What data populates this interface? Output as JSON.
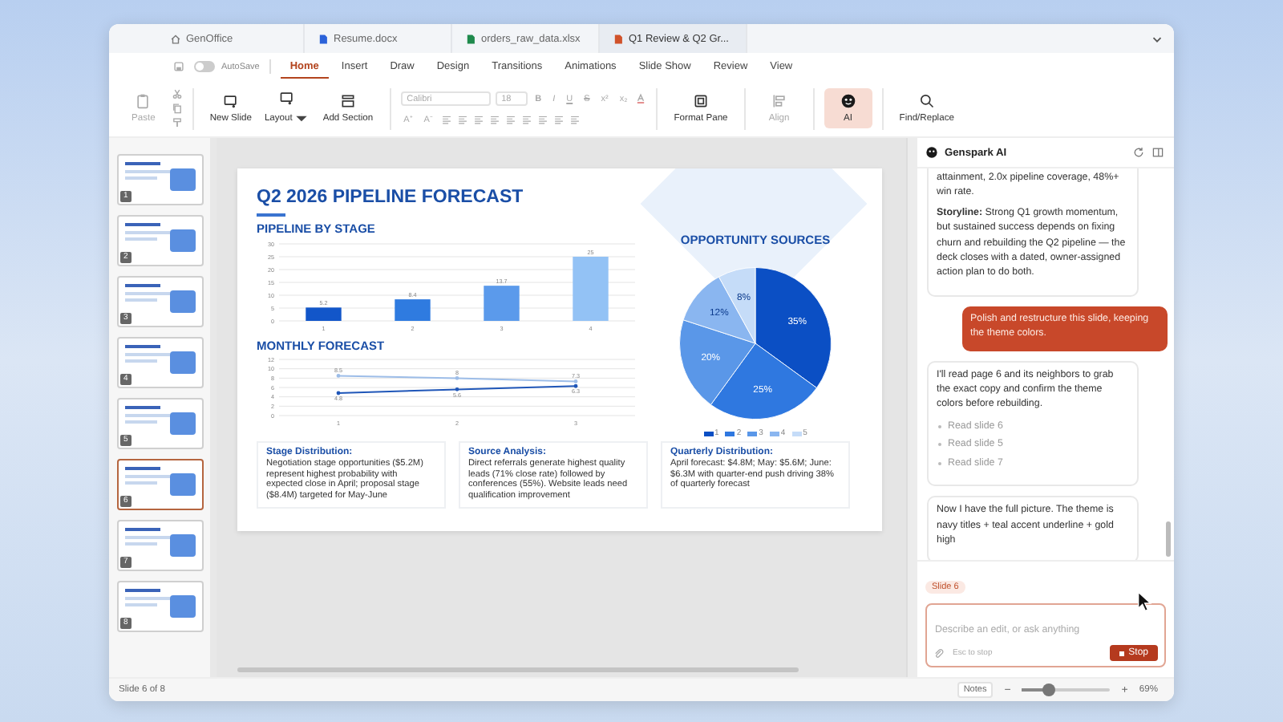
{
  "tabs": [
    {
      "label": "GenOffice",
      "kind": "home",
      "selected": false
    },
    {
      "label": "Resume.docx",
      "kind": "docx",
      "selected": false
    },
    {
      "label": "orders_raw_data.xlsx",
      "kind": "xlsx",
      "selected": false
    },
    {
      "label": "Q1 Review & Q2 Gr...",
      "kind": "pptx",
      "selected": true
    }
  ],
  "autosave": {
    "label": "AutoSave",
    "on": false
  },
  "menu": [
    {
      "label": "Home",
      "selected": true
    },
    {
      "label": "Insert",
      "selected": false
    },
    {
      "label": "Draw",
      "selected": false
    },
    {
      "label": "Design",
      "selected": false
    },
    {
      "label": "Transitions",
      "selected": false
    },
    {
      "label": "Animations",
      "selected": false
    },
    {
      "label": "Slide Show",
      "selected": false
    },
    {
      "label": "Review",
      "selected": false
    },
    {
      "label": "View",
      "selected": false
    }
  ],
  "ribbon": {
    "paste": {
      "label": "Paste",
      "disabled": true
    },
    "slide_buttons": [
      {
        "label": "New Slide",
        "kind": "new-slide"
      },
      {
        "label": "Layout",
        "kind": "layout"
      },
      {
        "label": "Add Section",
        "kind": "section"
      }
    ],
    "font": {
      "family": "Calibri",
      "size": "18",
      "disabled": true,
      "styles": [
        "B",
        "I",
        "U",
        "S",
        "x²",
        "x₂"
      ],
      "sizers": [
        "A⁺",
        "A⁻"
      ]
    },
    "tools": [
      {
        "label": "Format Pane",
        "kind": "format",
        "disabled": false,
        "selected": false
      },
      {
        "label": "Align",
        "kind": "align",
        "disabled": true,
        "selected": false
      },
      {
        "label": "AI",
        "kind": "ai",
        "disabled": false,
        "selected": true
      },
      {
        "label": "Find/Replace",
        "kind": "find",
        "disabled": false,
        "selected": false
      }
    ]
  },
  "thumbnails": [
    {
      "number": "1",
      "selected": false
    },
    {
      "number": "2",
      "selected": false
    },
    {
      "number": "3",
      "selected": false
    },
    {
      "number": "4",
      "selected": false
    },
    {
      "number": "5",
      "selected": false
    },
    {
      "number": "6",
      "selected": true
    },
    {
      "number": "7",
      "selected": false
    },
    {
      "number": "8",
      "selected": false
    }
  ],
  "slide": {
    "title": "Q2 2026 PIPELINE FORECAST",
    "bar_section": {
      "heading": "PIPELINE BY STAGE",
      "chart_data": {
        "type": "bar",
        "categories": [
          "1",
          "2",
          "3",
          "4"
        ],
        "values": [
          5.2,
          8.4,
          13.7,
          25
        ],
        "ylim": [
          0,
          30
        ],
        "yticks": [
          0,
          5,
          10,
          15,
          20,
          25,
          30
        ],
        "grid": true,
        "data_labels": true
      }
    },
    "line_section": {
      "heading": "MONTHLY FORECAST",
      "chart_data": {
        "type": "line",
        "categories": [
          "1",
          "2",
          "3"
        ],
        "series": [
          {
            "color": "#9dbde8",
            "values": [
              8.5,
              8,
              7.3
            ]
          },
          {
            "color": "#1f56b8",
            "values": [
              4.8,
              5.6,
              6.3
            ]
          }
        ],
        "ylim": [
          0,
          12
        ],
        "yticks": [
          0,
          2,
          4,
          6,
          8,
          10,
          12
        ],
        "grid": true,
        "data_labels": true
      }
    },
    "pie_section": {
      "heading": "OPPORTUNITY SOURCES",
      "chart_data": {
        "type": "pie",
        "categories": [
          "1",
          "2",
          "3",
          "4",
          "5"
        ],
        "values": [
          35,
          25,
          20,
          12,
          8
        ],
        "value_labels": [
          "35%",
          "25%",
          "20%",
          "12%",
          "8%"
        ]
      }
    },
    "notes": [
      {
        "title": "Stage Distribution:",
        "text": "Negotiation stage opportunities ($5.2M) represent highest probability with expected close in April; proposal stage ($8.4M) targeted for May-June"
      },
      {
        "title": "Source Analysis:",
        "text": "Direct referrals generate highest quality leads (71% close rate) followed by conferences (55%). Website leads need qualification improvement"
      },
      {
        "title": "Quarterly Distribution:",
        "text": "April forecast: $4.8M; May: $5.6M; June: $6.3M with quarter-end push driving 38% of quarterly forecast"
      }
    ]
  },
  "assistant": {
    "title": "Genspark AI",
    "messages": [
      {
        "kind": "assistant",
        "paragraphs": [
          "attainment, 2.0x pipeline coverage, 48%+ win rate.",
          "**Storyline:** Strong Q1 growth momentum, but sustained success depends on fixing churn and rebuilding the Q2 pipeline — the deck closes with a dated, owner-assigned action plan to do both."
        ]
      },
      {
        "kind": "user",
        "paragraphs": [
          "Polish and restructure this slide, keeping the theme colors."
        ]
      },
      {
        "kind": "assistant",
        "paragraphs": [
          "I'll read page 6 and its neighbors to grab the exact copy and confirm the theme colors before rebuilding."
        ],
        "steps": [
          "Read slide 6",
          "Read slide 5",
          "Read slide 7"
        ]
      },
      {
        "kind": "assistant",
        "paragraphs": [
          "Now I have the full picture. The theme is navy titles + teal accent underline + gold high"
        ]
      }
    ],
    "context_chip": "Slide 6",
    "placeholder": "Describe an edit, or ask anything",
    "hint": "Esc to stop",
    "stop": "Stop"
  },
  "status": {
    "slide": "Slide 6 of 8",
    "notes": "Notes",
    "minus": "−",
    "plus": "+",
    "zoom": {
      "level": 0.3
    },
    "zoom_text": "69%"
  }
}
